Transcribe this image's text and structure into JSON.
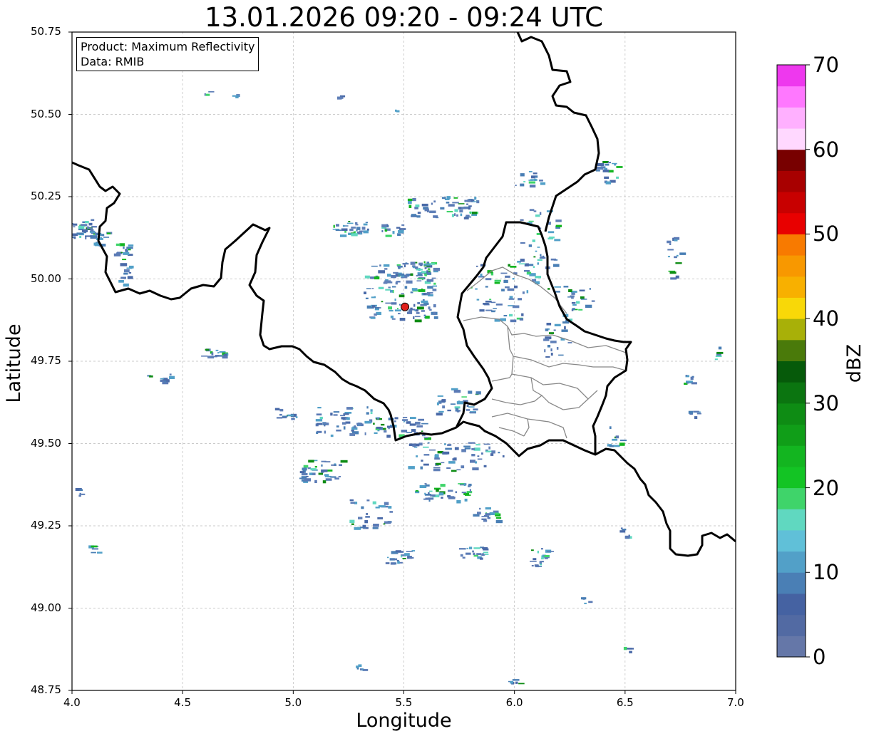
{
  "title": "13.01.2026 09:20 - 09:24 UTC",
  "xlabel": "Longitude",
  "ylabel": "Latitude",
  "info": {
    "line1": "Product: Maximum Reflectivity",
    "line2": "Data: RMIB"
  },
  "x_ticks": [
    "4.0",
    "4.5",
    "5.0",
    "5.5",
    "6.0",
    "6.5",
    "7.0"
  ],
  "y_ticks": [
    "50.75",
    "50.50",
    "50.25",
    "50.00",
    "49.75",
    "49.50",
    "49.25",
    "49.00",
    "48.75"
  ],
  "colorbar": {
    "label": "dBZ",
    "ticks": [
      "0",
      "10",
      "20",
      "30",
      "40",
      "50",
      "60",
      "70"
    ],
    "colors": [
      "#6577a8",
      "#526aa3",
      "#4562a2",
      "#4a7fb5",
      "#52a0c8",
      "#60c0d8",
      "#60d8c0",
      "#3fd46a",
      "#13c424",
      "#13b520",
      "#109e18",
      "#0e8c14",
      "#0b7510",
      "#065a0a",
      "#4a7a0a",
      "#a8b008",
      "#f8d808",
      "#f8b000",
      "#f89800",
      "#f87a00",
      "#e80000",
      "#c80000",
      "#a80000",
      "#780000",
      "#ffd8ff",
      "#ffb0ff",
      "#ff78ff",
      "#ee38ee"
    ]
  },
  "radar_site": {
    "lon": 5.505,
    "lat": 49.915
  },
  "chart_data": {
    "type": "map",
    "x_range": [
      4.0,
      7.0
    ],
    "y_range": [
      48.75,
      50.75
    ],
    "grid": true,
    "colorbar_range": [
      0,
      70
    ]
  }
}
